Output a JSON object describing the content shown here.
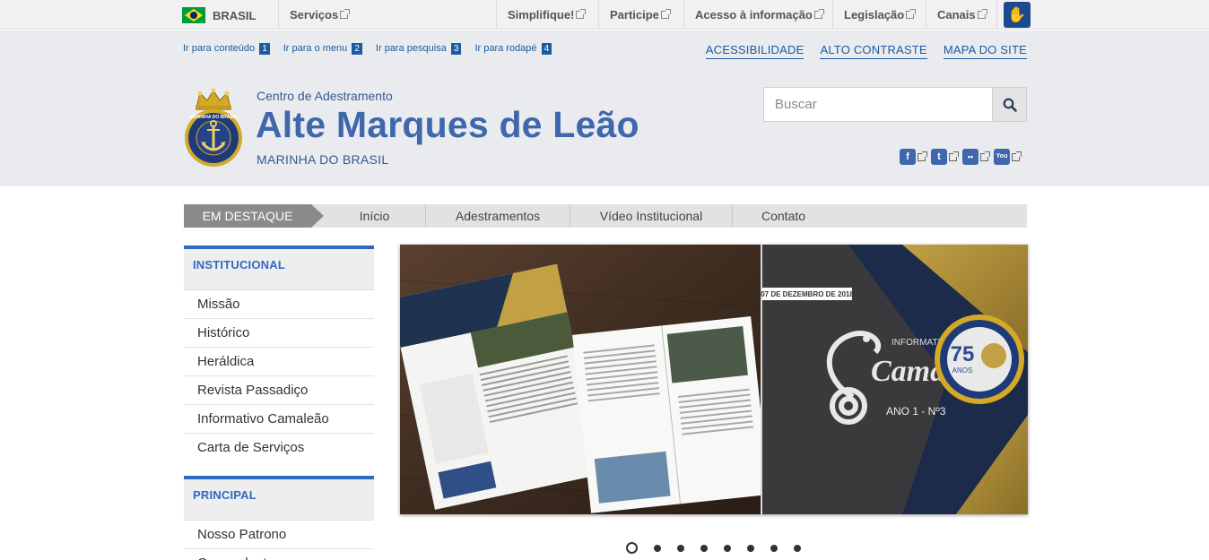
{
  "govbar": {
    "country": "BRASIL",
    "items": [
      {
        "label": "Serviços"
      },
      {
        "label": "Simplifique!"
      },
      {
        "label": "Participe"
      },
      {
        "label": "Acesso à informação"
      },
      {
        "label": "Legislação"
      },
      {
        "label": "Canais"
      }
    ]
  },
  "skip_links": [
    {
      "label": "Ir para conteúdo",
      "num": "1"
    },
    {
      "label": "Ir para o menu",
      "num": "2"
    },
    {
      "label": "Ir para pesquisa",
      "num": "3"
    },
    {
      "label": "Ir para rodapé",
      "num": "4"
    }
  ],
  "top_links": [
    "ACESSIBILIDADE",
    "ALTO CONTRASTE",
    "MAPA DO SITE"
  ],
  "header": {
    "subtitle": "Centro de Adestramento",
    "title": "Alte Marques de Leão",
    "org": "MARINHA DO BRASIL",
    "logo_text": "MARINHA DO BRASIL"
  },
  "search": {
    "placeholder": "Buscar"
  },
  "social": [
    "f",
    "t",
    "••",
    "You"
  ],
  "nav": {
    "highlight": "EM DESTAQUE",
    "items": [
      "Início",
      "Adestramentos",
      "Vídeo Institucional",
      "Contato"
    ]
  },
  "sidebar": {
    "sections": [
      {
        "title": "INSTITUCIONAL",
        "items": [
          "Missão",
          "Histórico",
          "Heráldica",
          "Revista Passadiço",
          "Informativo Camaleão",
          "Carta de Serviços"
        ]
      },
      {
        "title": "PRINCIPAL",
        "items": [
          "Nosso Patrono",
          "Comandantes"
        ]
      }
    ]
  },
  "carousel": {
    "date": "07 DE DEZEMBRO DE 2018",
    "kicker": "INFORMATIVO",
    "name": "Camaleão",
    "edition": "ANO 1 - Nº3",
    "badge_number": "75",
    "badge_word": "ANOS",
    "total_slides": 8,
    "active_slide": 1
  },
  "colors": {
    "brand_blue": "#3f67ac",
    "nav_gray": "#8a8a8a",
    "accent_blue": "#2e6ac2"
  }
}
